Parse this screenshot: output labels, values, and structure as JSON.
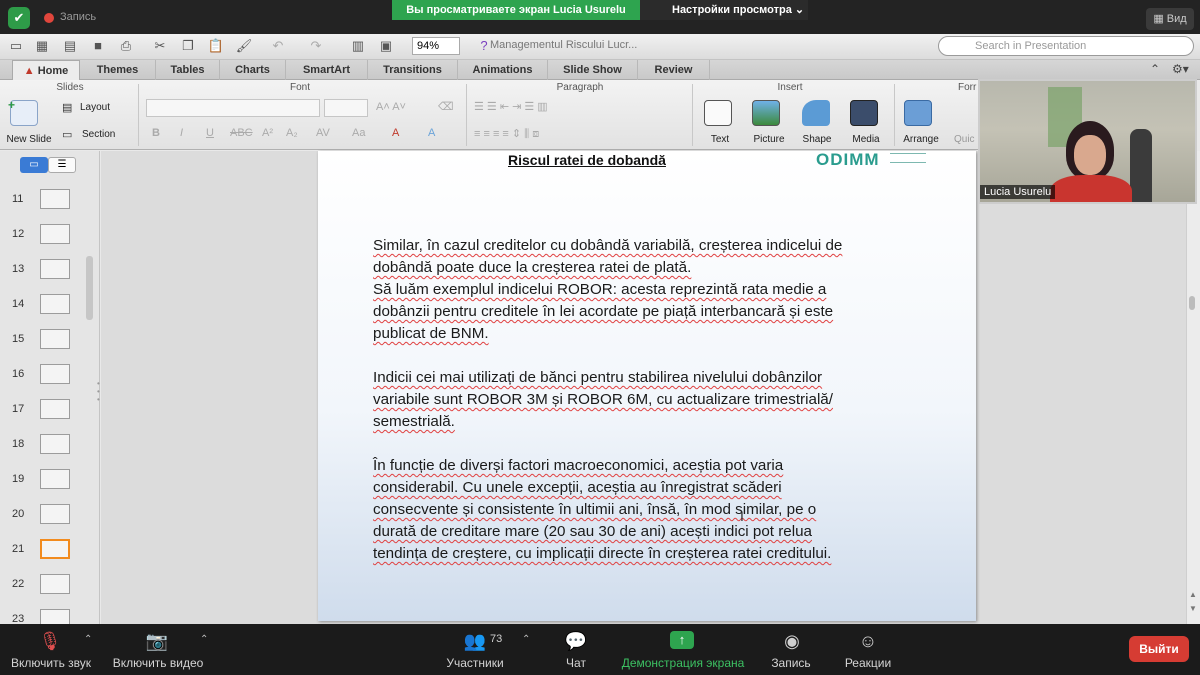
{
  "zoom_top": {
    "recording_label": "Запись",
    "share_banner": "Вы просматриваете экран Lucia Usurelu",
    "view_options": "Настройки просмотра",
    "view_button": "Вид"
  },
  "ppt": {
    "doc_title": "Managementul Riscului Lucr...",
    "zoom_level": "94%",
    "search_placeholder": "Search in Presentation",
    "tabs": [
      "Home",
      "Themes",
      "Tables",
      "Charts",
      "SmartArt",
      "Transitions",
      "Animations",
      "Slide Show",
      "Review"
    ],
    "groups": {
      "slides": "Slides",
      "font": "Font",
      "paragraph": "Paragraph",
      "insert": "Insert",
      "format": "Forr"
    },
    "buttons": {
      "new_slide": "New Slide",
      "layout": "Layout",
      "section": "Section",
      "text": "Text",
      "picture": "Picture",
      "shape": "Shape",
      "media": "Media",
      "arrange": "Arrange",
      "quick": "Quic"
    },
    "slide_numbers": [
      "11",
      "12",
      "13",
      "14",
      "15",
      "16",
      "17",
      "18",
      "19",
      "20",
      "21",
      "22",
      "23"
    ],
    "selected_slide": "21"
  },
  "slide": {
    "title": "Riscul ratei de dobandă",
    "logo": "ODIMM",
    "paragraphs": [
      [
        "Similar, în cazul creditelor cu dobândă variabilă, creșterea indicelui de",
        "dobândă poate duce la creșterea ratei de plată.",
        "Să luăm exemplul indicelui ROBOR: acesta reprezintă rata medie a",
        "dobânzii pentru creditele în lei acordate pe piață interbancară și este",
        "publicat de BNM."
      ],
      [
        "Indicii cei mai utilizați de bănci pentru stabilirea nivelului dobânzilor",
        "variabile sunt ROBOR 3M și ROBOR 6M, cu actualizare trimestrială/",
        "semestrială."
      ],
      [
        "În funcție de diverși factori macroeconomici, aceștia pot varia",
        "considerabil. Cu unele excepții, aceștia au înregistrat scăderi",
        "consecvente și consistente în ultimii ani, însă, în mod similar, pe o",
        "durată de creditare mare (20 sau 30 de ani) acești indici pot relua",
        "tendința de creștere, cu implicații directe în creșterea ratei creditului."
      ]
    ]
  },
  "video": {
    "participant_name": "Lucia Usurelu"
  },
  "zoom_bottom": {
    "audio": "Включить звук",
    "video": "Включить видео",
    "participants": "Участники",
    "participants_count": "73",
    "chat": "Чат",
    "share": "Демонстрация экрана",
    "record": "Запись",
    "reactions": "Реакции",
    "leave": "Выйти"
  },
  "colors": {
    "share_green": "#2ea44f",
    "leave_red": "#d63c33",
    "selected_slide_border": "#f28b1e",
    "logo_teal": "#2a9c8e"
  }
}
